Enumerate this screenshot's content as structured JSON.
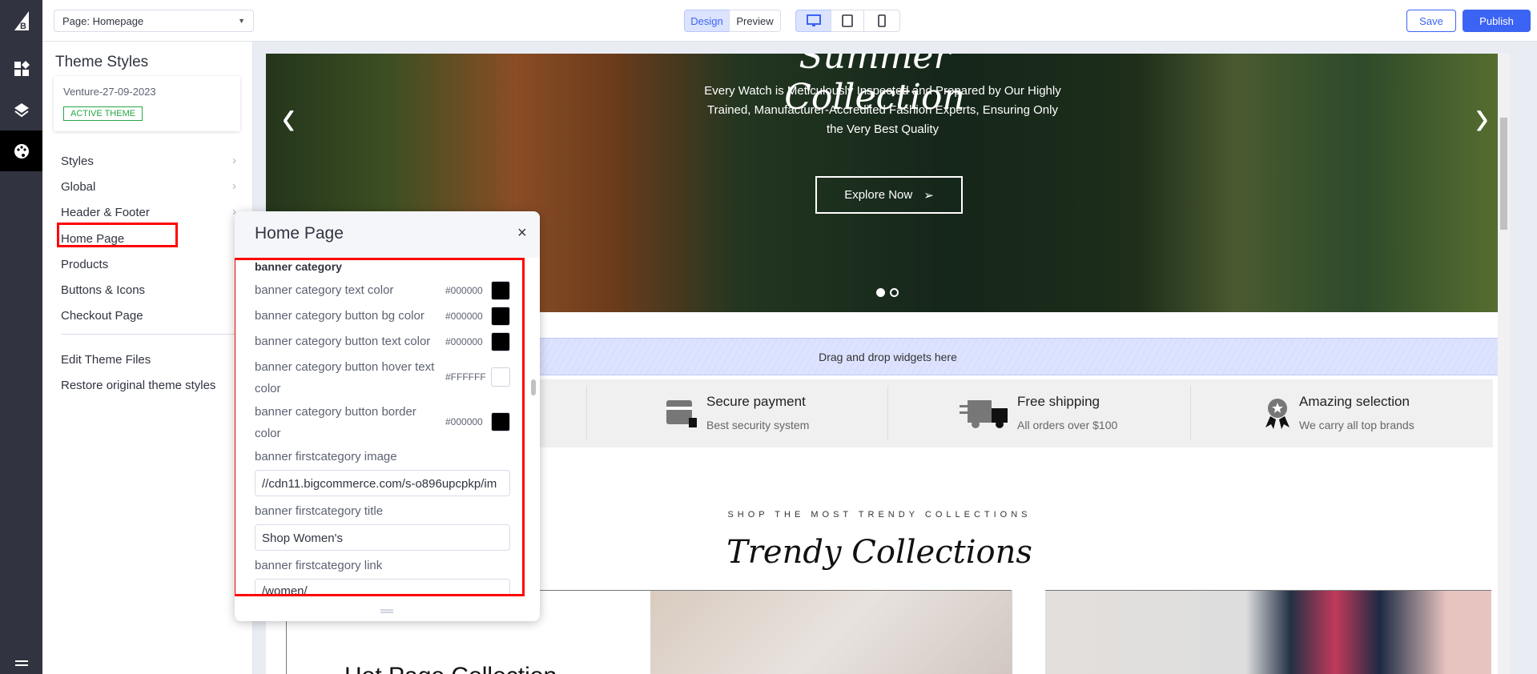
{
  "app": {
    "logo": "bigcommerce-logo"
  },
  "rail": {
    "icons": [
      "widgets-icon",
      "layers-icon",
      "palette-icon"
    ],
    "menu_icon": "menu-icon"
  },
  "topbar": {
    "page_select": "Page: Homepage",
    "design": "Design",
    "preview": "Preview",
    "devices": [
      "desktop-icon",
      "tablet-icon",
      "mobile-icon"
    ],
    "save": "Save",
    "publish": "Publish"
  },
  "sidebar": {
    "title": "Theme Styles",
    "theme_name": "Venture-27-09-2023",
    "badge": "ACTIVE THEME",
    "items": [
      {
        "label": "Styles"
      },
      {
        "label": "Global"
      },
      {
        "label": "Header & Footer"
      },
      {
        "label": "Home Page"
      },
      {
        "label": "Products"
      },
      {
        "label": "Buttons & Icons"
      },
      {
        "label": "Checkout Page"
      }
    ],
    "edit_files": "Edit Theme Files",
    "restore": "Restore original theme styles"
  },
  "popup": {
    "title": "Home Page",
    "section": "banner category",
    "colors": [
      {
        "label": "banner category text color",
        "hex": "#000000"
      },
      {
        "label": "banner category button bg color",
        "hex": "#000000"
      },
      {
        "label": "banner category button text color",
        "hex": "#000000"
      },
      {
        "label": "banner category button hover text color",
        "hex": "#FFFFFF"
      },
      {
        "label": "banner category button border color",
        "hex": "#000000"
      }
    ],
    "fields": [
      {
        "label": "banner firstcategory image",
        "value": "//cdn11.bigcommerce.com/s-o896upcpkp/im"
      },
      {
        "label": "banner firstcategory title",
        "value": "Shop Women's"
      },
      {
        "label": "banner firstcategory link",
        "value": "/women/"
      }
    ]
  },
  "hero": {
    "title": "Summer Collection",
    "text": "Every Watch is Meticulously Inspected and Prepared by Our Highly Trained, Manufacturer-Accredited Fashion Experts, Ensuring Only the Very Best Quality",
    "cta": "Explore Now"
  },
  "dropzone": "Drag and drop widgets here",
  "features": [
    {
      "icon": "credit-card-lock-icon",
      "title": "Secure payment",
      "sub": "Best security system"
    },
    {
      "icon": "truck-icon",
      "title": "Free shipping",
      "sub": "All orders over $100"
    },
    {
      "icon": "award-icon",
      "title": "Amazing selection",
      "sub": "We carry all top brands"
    }
  ],
  "collections": {
    "kicker": "SHOP THE MOST TRENDY COLLECTIONS",
    "title": "Trendy Collections",
    "card1_title": "Hot Page Collection"
  },
  "colors": {
    "accent": "#3c64f4",
    "highlight": "#ff0000",
    "active_badge": "#28a745"
  }
}
